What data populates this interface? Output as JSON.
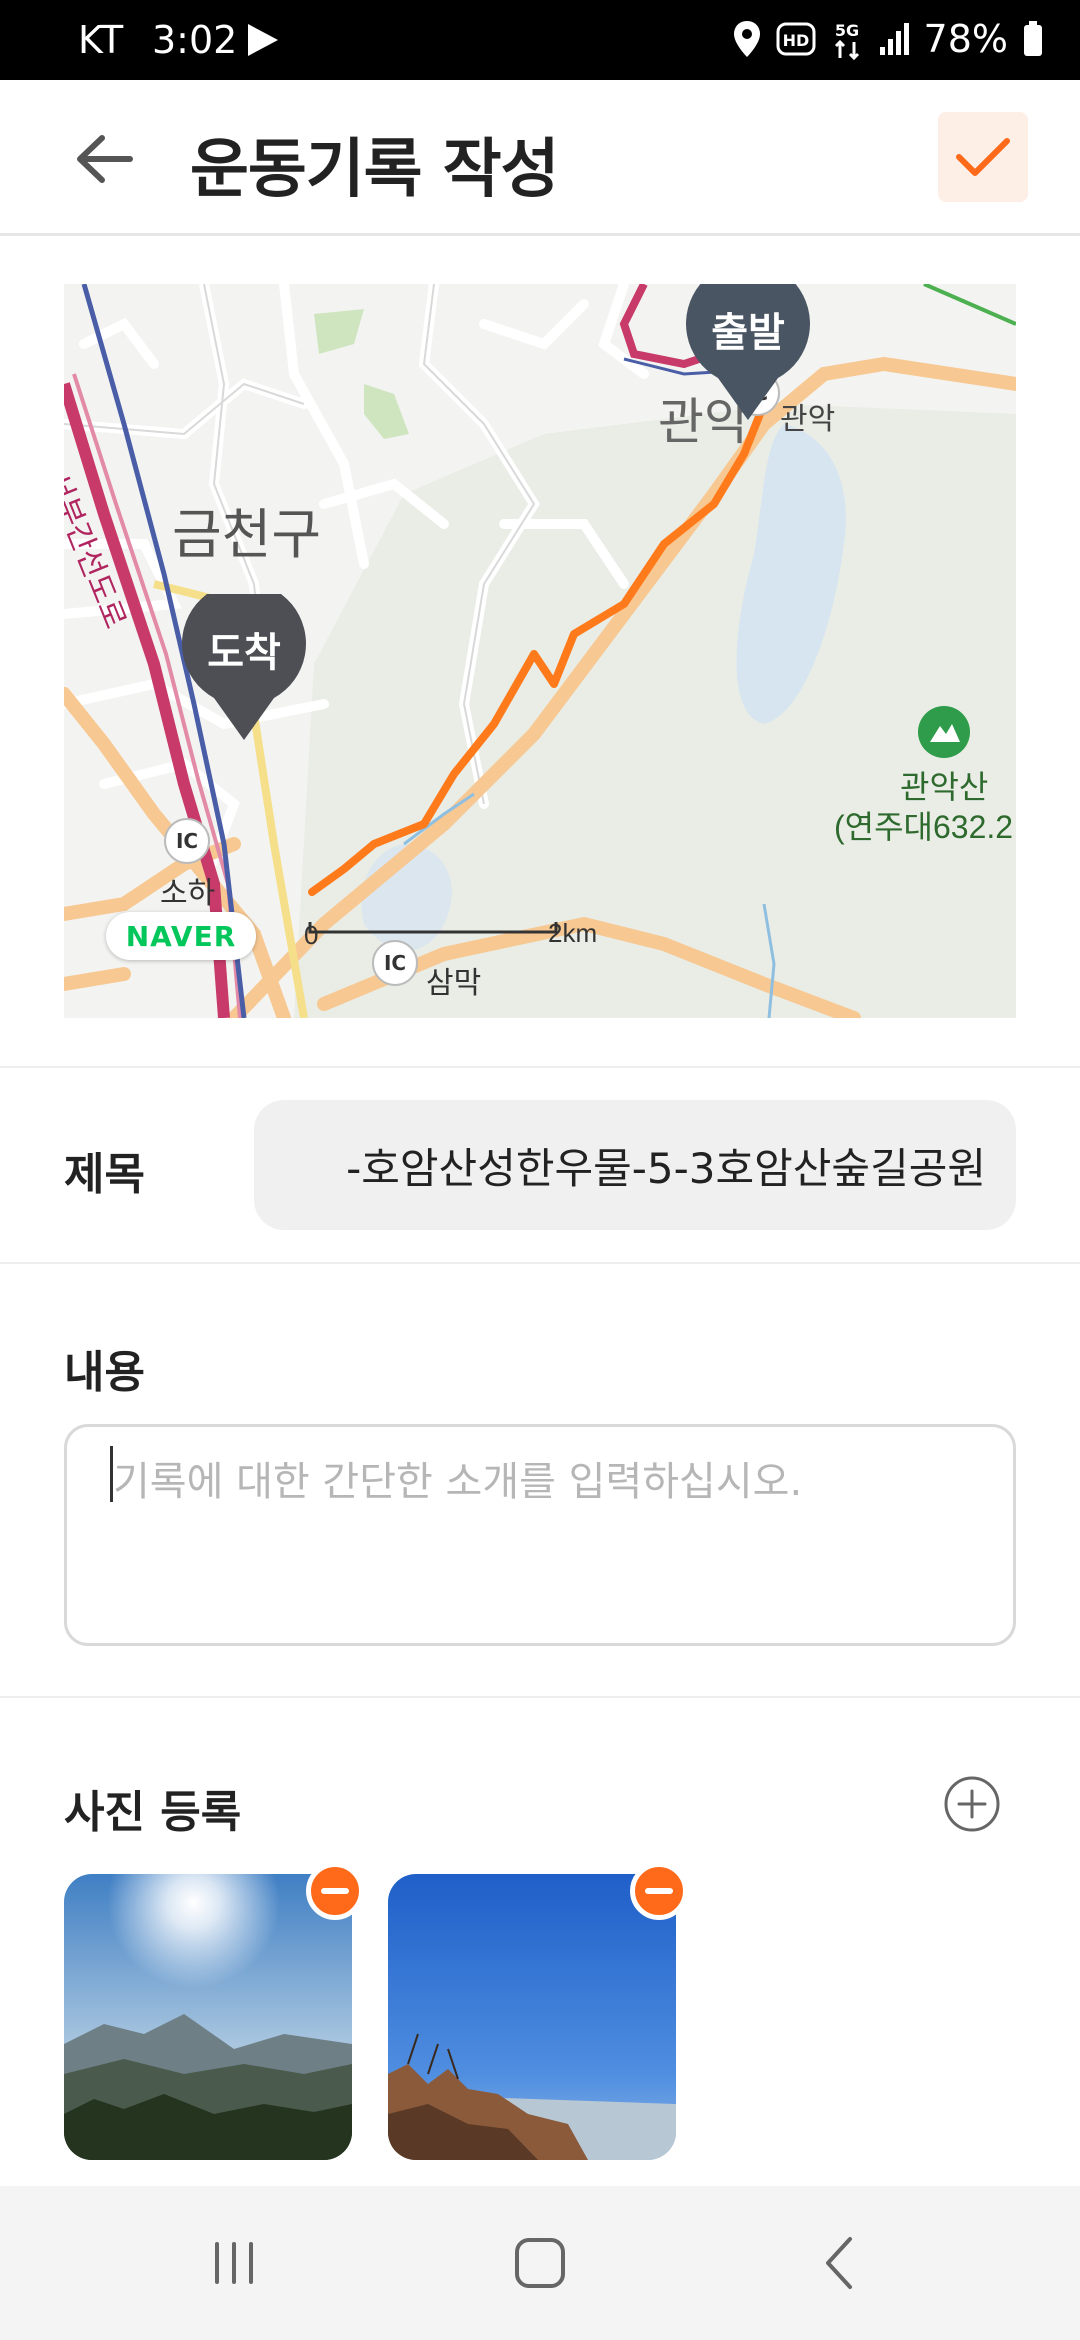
{
  "status_bar": {
    "carrier": "KT",
    "time": "3:02",
    "battery": "78%",
    "icons": [
      "play-icon",
      "location-icon",
      "hd-icon",
      "5g-icon",
      "signal-icon",
      "battery-icon"
    ]
  },
  "header": {
    "title": "운동기록 작성",
    "back_icon": "arrow-left-icon",
    "confirm_icon": "check-icon",
    "accent_color": "#ff6a1a"
  },
  "map": {
    "district_label": "금천구",
    "area_label": "관악",
    "road_label": "관악",
    "road_vertical_label": "서부간선도로",
    "mountain_name": "관악산",
    "mountain_height": "(연주대632.2",
    "ic_soha": "IC",
    "soha_label": "소하",
    "ic_sammak": "IC",
    "sammak_label": "삼막",
    "ic_gwanak": "IC",
    "scale_start": "0",
    "scale_end": "2km",
    "naver_logo": "NAVER",
    "start_pin": "출발",
    "end_pin": "도착",
    "route_color": "#ff7a1a"
  },
  "form": {
    "title_label": "제목",
    "title_value": "-호암산성한우물-5-3호암산숲길공원",
    "content_label": "내용",
    "content_placeholder": "기록에 대한 간단한 소개를 입력하십시오.",
    "content_value": "",
    "photo_label": "사진 등록",
    "add_photo_icon": "plus-circle-icon",
    "photos": [
      {
        "name": "photo-mountain-sun",
        "remove_icon": "minus-icon"
      },
      {
        "name": "photo-blue-sky",
        "remove_icon": "minus-icon"
      }
    ]
  },
  "nav_bar": {
    "recent_icon": "recent-apps-icon",
    "home_icon": "home-icon",
    "back_icon": "back-chevron-icon"
  }
}
